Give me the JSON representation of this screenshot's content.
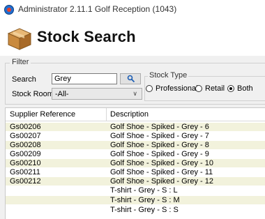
{
  "window": {
    "title": "Administrator 2.11.1 Golf Reception (1043)"
  },
  "header": {
    "title": "Stock Search"
  },
  "filter": {
    "legend": "Filter",
    "search_label": "Search",
    "search_value": "Grey",
    "stock_room_label": "Stock Room",
    "stock_room_value": "-All-",
    "stock_type": {
      "legend": "Stock Type",
      "options": [
        "Professional",
        "Retail",
        "Both"
      ],
      "selected": "Both"
    }
  },
  "grid": {
    "columns": [
      "Supplier Reference",
      "Description"
    ],
    "rows": [
      {
        "ref": "Gs00206",
        "desc": "Golf Shoe - Spiked - Grey -  6"
      },
      {
        "ref": "Gs00207",
        "desc": "Golf Shoe - Spiked - Grey -  7"
      },
      {
        "ref": "Gs00208",
        "desc": "Golf Shoe - Spiked - Grey -  8"
      },
      {
        "ref": "Gs00209",
        "desc": "Golf Shoe - Spiked - Grey -  9"
      },
      {
        "ref": "Gs00210",
        "desc": "Golf Shoe - Spiked - Grey - 10"
      },
      {
        "ref": "Gs00211",
        "desc": "Golf Shoe - Spiked - Grey - 11"
      },
      {
        "ref": "Gs00212",
        "desc": "Golf Shoe - Spiked - Grey - 12"
      },
      {
        "ref": "",
        "desc": "T-shirt - Grey - S : L"
      },
      {
        "ref": "",
        "desc": "T-shirt - Grey - S : M"
      },
      {
        "ref": "",
        "desc": "T-shirt - Grey - S : S"
      }
    ]
  },
  "icons": {
    "app": "app-logo-icon",
    "box": "stock-box-icon",
    "search": "search-icon"
  }
}
